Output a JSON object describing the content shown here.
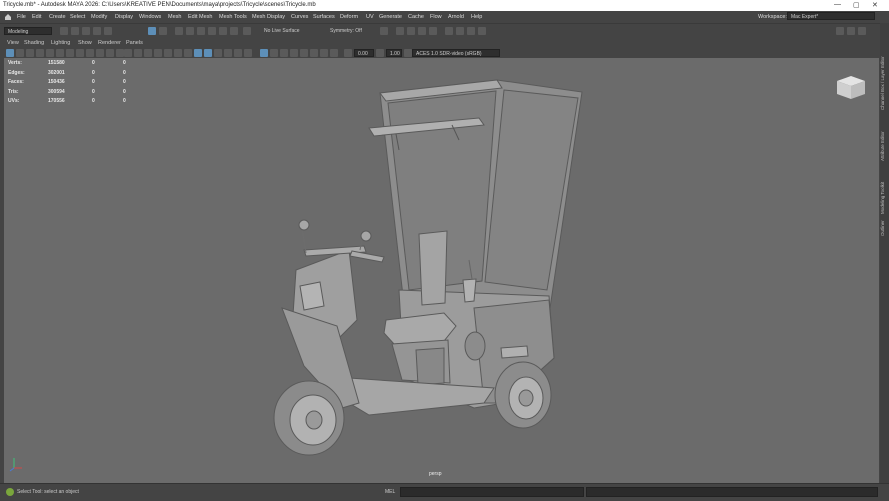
{
  "window": {
    "title": "Tricycle.mb* - Autodesk MAYA 2026: C:\\Users\\KREATIVE PEN\\Documents\\maya\\projects\\Tricycle\\scenes\\Tricycle.mb",
    "controls": [
      "—",
      "▢",
      "✕"
    ]
  },
  "menubar": {
    "items": [
      "File",
      "Edit",
      "Create",
      "Select",
      "Modify",
      "Display",
      "Windows",
      "Mesh",
      "Edit Mesh",
      "Mesh Tools",
      "Mesh Display",
      "Curves",
      "Surfaces",
      "Deform",
      "UV",
      "Generate",
      "Cache",
      "Flow",
      "Arnold",
      "Help"
    ],
    "workspace_label": "Workspace:",
    "workspace_value": "Mac Expert*"
  },
  "statusline": {
    "mode": "Modeling",
    "live_surface": "No Live Surface",
    "symmetry": "Symmetry: Off"
  },
  "panel_menu": {
    "items": [
      "View",
      "Shading",
      "Lighting",
      "Show",
      "Renderer",
      "Panels"
    ]
  },
  "panel_toolbar": {
    "exposure": "0.00",
    "gamma": "1.00",
    "colorspace": "ACES 1.0 SDR-video (sRGB)"
  },
  "hud": {
    "rows": [
      {
        "label": "Verts:",
        "v1": "151580",
        "v2": "0",
        "v3": "0"
      },
      {
        "label": "Edges:",
        "v1": "302001",
        "v2": "0",
        "v3": "0"
      },
      {
        "label": "Faces:",
        "v1": "150436",
        "v2": "0",
        "v3": "0"
      },
      {
        "label": "Tris:",
        "v1": "300594",
        "v2": "0",
        "v3": "0"
      },
      {
        "label": "UVs:",
        "v1": "170556",
        "v2": "0",
        "v3": "0"
      }
    ]
  },
  "viewport": {
    "camera": "persp",
    "background": "#6b6b6b",
    "model_color": "#9a9a9a"
  },
  "right_tabs": [
    "Channel Box / Layer Editor",
    "Attribute Editor",
    "Modeling Toolkit",
    "Outliner"
  ],
  "footer": {
    "help_text": "Select Tool: select an object",
    "mel_label": "MEL"
  }
}
